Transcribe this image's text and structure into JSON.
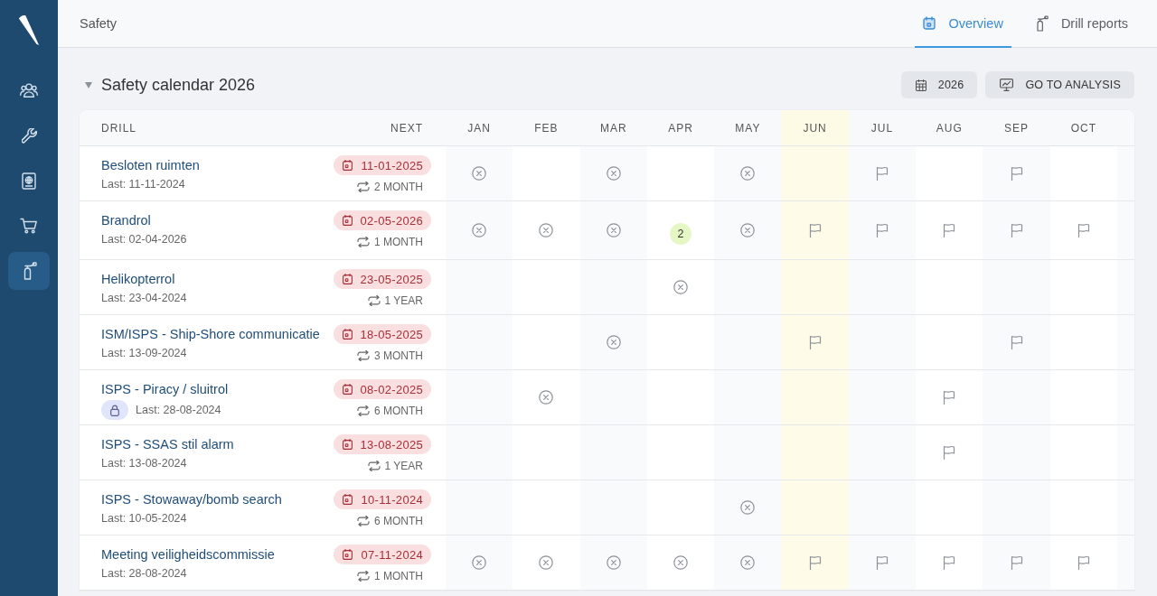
{
  "sidebar": {
    "items": [
      {
        "selected": false
      },
      {
        "selected": false
      },
      {
        "selected": false
      },
      {
        "selected": false
      },
      {
        "selected": true
      }
    ]
  },
  "header": {
    "breadcrumb": "Safety",
    "tabs": [
      {
        "label": "Overview",
        "selected": true
      },
      {
        "label": "Drill reports",
        "selected": false
      }
    ]
  },
  "section": {
    "title": "Safety calendar 2026",
    "expanded": true,
    "buttons": [
      {
        "label": "2026"
      },
      {
        "label": "GO TO ANALYSIS"
      }
    ]
  },
  "table": {
    "columns": [
      {
        "label": "DRILL"
      },
      {
        "label": "NEXT"
      }
    ],
    "months": [
      {
        "label": "JAN",
        "current": false
      },
      {
        "label": "FEB",
        "current": false
      },
      {
        "label": "MAR",
        "current": false
      },
      {
        "label": "APR",
        "current": false
      },
      {
        "label": "MAY",
        "current": false
      },
      {
        "label": "JUN",
        "current": true
      },
      {
        "label": "JUL",
        "current": false
      },
      {
        "label": "AUG",
        "current": false
      },
      {
        "label": "SEP",
        "current": false
      },
      {
        "label": "OCT",
        "current": false
      }
    ],
    "rows": [
      {
        "name": "Besloten ruimten",
        "last": "Last: 11-11-2024",
        "locked": false,
        "next": "11-01-2025",
        "interval": "2 MONTH",
        "cells": [
          {
            "kind": "cross"
          },
          {
            "kind": "empty"
          },
          {
            "kind": "cross"
          },
          {
            "kind": "empty"
          },
          {
            "kind": "cross"
          },
          {
            "kind": "empty"
          },
          {
            "kind": "flag"
          },
          {
            "kind": "empty"
          },
          {
            "kind": "flag"
          },
          {
            "kind": "empty"
          }
        ]
      },
      {
        "name": "Brandrol",
        "last": "Last: 02-04-2026",
        "locked": false,
        "next": "02-05-2026",
        "interval": "1 MONTH",
        "cells": [
          {
            "kind": "cross"
          },
          {
            "kind": "cross"
          },
          {
            "kind": "cross"
          },
          {
            "kind": "count",
            "count": "2"
          },
          {
            "kind": "cross"
          },
          {
            "kind": "flag"
          },
          {
            "kind": "flag"
          },
          {
            "kind": "flag"
          },
          {
            "kind": "flag"
          },
          {
            "kind": "flag"
          }
        ]
      },
      {
        "name": "Helikopterrol",
        "last": "Last: 23-04-2024",
        "locked": false,
        "next": "23-05-2025",
        "interval": "1 YEAR",
        "cells": [
          {
            "kind": "empty"
          },
          {
            "kind": "empty"
          },
          {
            "kind": "empty"
          },
          {
            "kind": "cross"
          },
          {
            "kind": "empty"
          },
          {
            "kind": "empty"
          },
          {
            "kind": "empty"
          },
          {
            "kind": "empty"
          },
          {
            "kind": "empty"
          },
          {
            "kind": "empty"
          }
        ]
      },
      {
        "name": "ISM/ISPS - Ship-Shore communicatie",
        "last": "Last: 13-09-2024",
        "locked": false,
        "next": "18-05-2025",
        "interval": "3 MONTH",
        "cells": [
          {
            "kind": "empty"
          },
          {
            "kind": "empty"
          },
          {
            "kind": "cross"
          },
          {
            "kind": "empty"
          },
          {
            "kind": "empty"
          },
          {
            "kind": "flag"
          },
          {
            "kind": "empty"
          },
          {
            "kind": "empty"
          },
          {
            "kind": "flag"
          },
          {
            "kind": "empty"
          }
        ]
      },
      {
        "name": "ISPS - Piracy / sluitrol",
        "last": "Last: 28-08-2024",
        "locked": true,
        "next": "08-02-2025",
        "interval": "6 MONTH",
        "cells": [
          {
            "kind": "empty"
          },
          {
            "kind": "cross"
          },
          {
            "kind": "empty"
          },
          {
            "kind": "empty"
          },
          {
            "kind": "empty"
          },
          {
            "kind": "empty"
          },
          {
            "kind": "empty"
          },
          {
            "kind": "flag"
          },
          {
            "kind": "empty"
          },
          {
            "kind": "empty"
          }
        ]
      },
      {
        "name": "ISPS - SSAS stil alarm",
        "last": "Last: 13-08-2024",
        "locked": false,
        "next": "13-08-2025",
        "interval": "1 YEAR",
        "cells": [
          {
            "kind": "empty"
          },
          {
            "kind": "empty"
          },
          {
            "kind": "empty"
          },
          {
            "kind": "empty"
          },
          {
            "kind": "empty"
          },
          {
            "kind": "empty"
          },
          {
            "kind": "empty"
          },
          {
            "kind": "flag"
          },
          {
            "kind": "empty"
          },
          {
            "kind": "empty"
          }
        ]
      },
      {
        "name": "ISPS - Stowaway/bomb search",
        "last": "Last: 10-05-2024",
        "locked": false,
        "next": "10-11-2024",
        "interval": "6 MONTH",
        "cells": [
          {
            "kind": "empty"
          },
          {
            "kind": "empty"
          },
          {
            "kind": "empty"
          },
          {
            "kind": "empty"
          },
          {
            "kind": "cross"
          },
          {
            "kind": "empty"
          },
          {
            "kind": "empty"
          },
          {
            "kind": "empty"
          },
          {
            "kind": "empty"
          },
          {
            "kind": "empty"
          }
        ]
      },
      {
        "name": "Meeting veiligheidscommissie",
        "last": "Last: 28-08-2024",
        "locked": false,
        "next": "07-11-2024",
        "interval": "1 MONTH",
        "cells": [
          {
            "kind": "cross"
          },
          {
            "kind": "cross"
          },
          {
            "kind": "cross"
          },
          {
            "kind": "cross"
          },
          {
            "kind": "cross"
          },
          {
            "kind": "flag"
          },
          {
            "kind": "flag"
          },
          {
            "kind": "flag"
          },
          {
            "kind": "flag"
          },
          {
            "kind": "flag"
          }
        ]
      }
    ]
  }
}
